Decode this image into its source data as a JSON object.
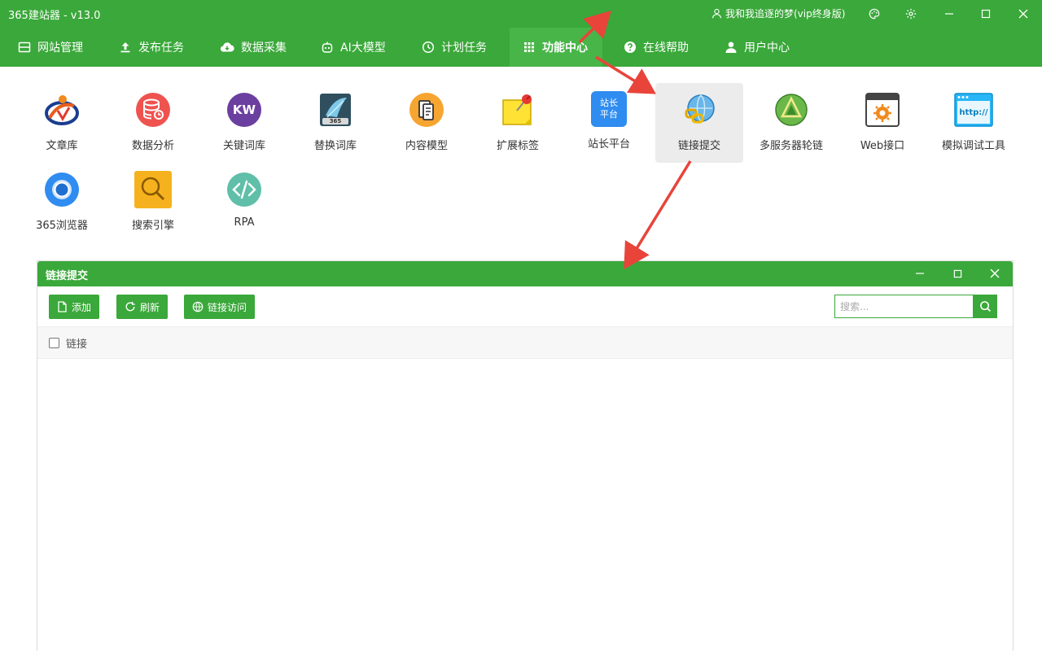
{
  "app": {
    "title": "365建站器 - v13.0",
    "user_label": "我和我追逐的梦(vip终身版)"
  },
  "nav": {
    "items": [
      {
        "label": "网站管理",
        "icon": "monitor-icon"
      },
      {
        "label": "发布任务",
        "icon": "upload-icon"
      },
      {
        "label": "数据采集",
        "icon": "cloud-download-icon"
      },
      {
        "label": "AI大模型",
        "icon": "robot-icon"
      },
      {
        "label": "计划任务",
        "icon": "clock-icon"
      },
      {
        "label": "功能中心",
        "icon": "grid-icon",
        "active": true
      },
      {
        "label": "在线帮助",
        "icon": "help-icon"
      },
      {
        "label": "用户中心",
        "icon": "user-icon"
      }
    ]
  },
  "features": [
    {
      "label": "文章库"
    },
    {
      "label": "数据分析"
    },
    {
      "label": "关键词库",
      "icon_text": "KW"
    },
    {
      "label": "替换词库",
      "icon_text": "365"
    },
    {
      "label": "内容模型"
    },
    {
      "label": "扩展标签"
    },
    {
      "label": "站长平台",
      "icon_text_1": "站长",
      "icon_text_2": "平台"
    },
    {
      "label": "链接提交",
      "selected": true
    },
    {
      "label": "多服务器轮链"
    },
    {
      "label": "Web接口"
    },
    {
      "label": "模拟调试工具",
      "icon_text": "http://"
    },
    {
      "label": "365浏览器"
    },
    {
      "label": "搜索引擎"
    },
    {
      "label": "RPA"
    }
  ],
  "panel": {
    "title": "链接提交",
    "toolbar": {
      "add_label": "添加",
      "refresh_label": "刷新",
      "visit_label": "链接访问"
    },
    "search": {
      "placeholder": "搜索...",
      "value": ""
    },
    "table": {
      "columns": [
        "链接"
      ],
      "rows": []
    }
  },
  "colors": {
    "primary": "#3aa83a",
    "arrow": "#e8443a",
    "selected_bg": "#ececec"
  }
}
